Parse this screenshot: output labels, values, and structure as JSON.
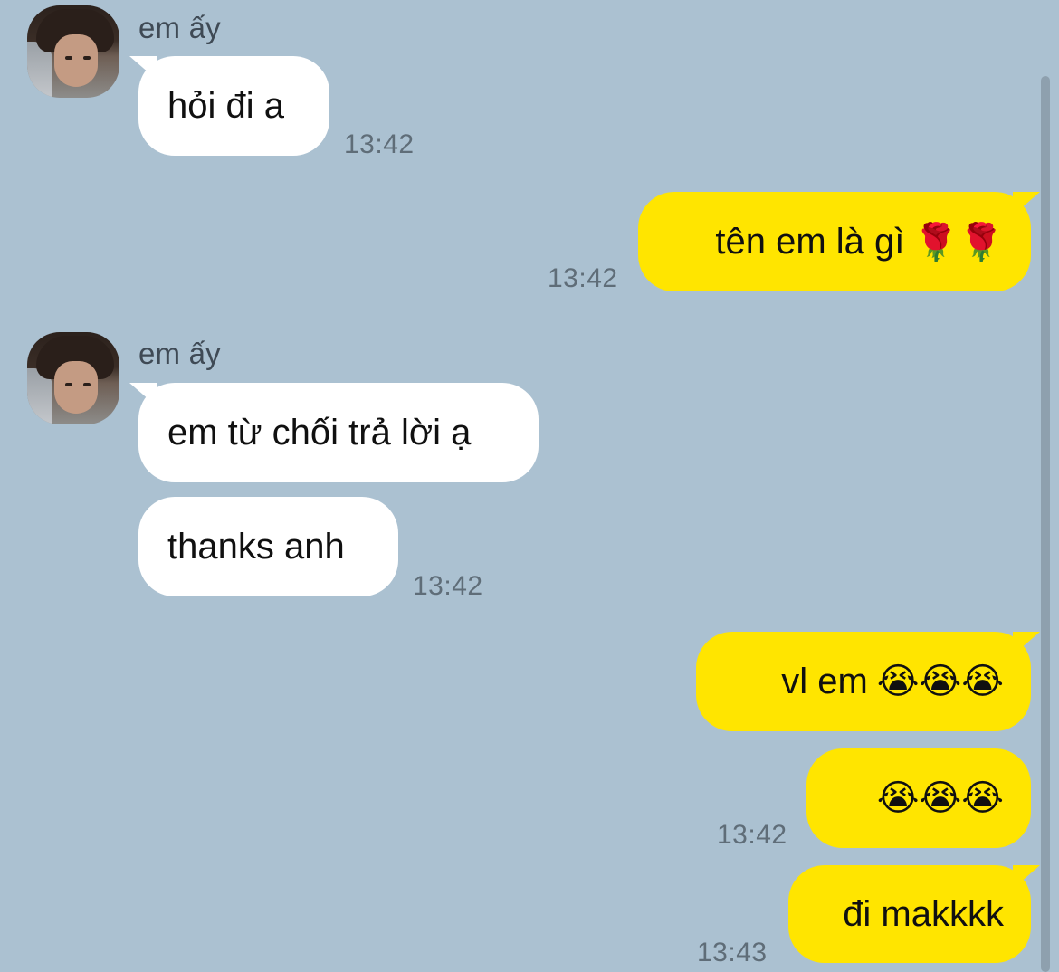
{
  "contact": {
    "name": "em ấy"
  },
  "messages": [
    {
      "side": "in",
      "text": "hỏi đi a",
      "time": "13:42"
    },
    {
      "side": "out",
      "text": "tên em là gì",
      "emoji": "🌹🌹",
      "time": "13:42"
    },
    {
      "side": "in",
      "text": "em từ chối trả lời ạ"
    },
    {
      "side": "in",
      "text": "thanks anh",
      "time": "13:42"
    },
    {
      "side": "out",
      "text": "vl em",
      "emoji": "😭😭😭"
    },
    {
      "side": "out",
      "text": "",
      "emoji": "😭😭😭",
      "time": "13:42"
    },
    {
      "side": "out",
      "text": "đi makkkk",
      "time": "13:43"
    }
  ],
  "colors": {
    "background": "#abc1d1",
    "incoming": "#ffffff",
    "outgoing": "#ffe500"
  }
}
